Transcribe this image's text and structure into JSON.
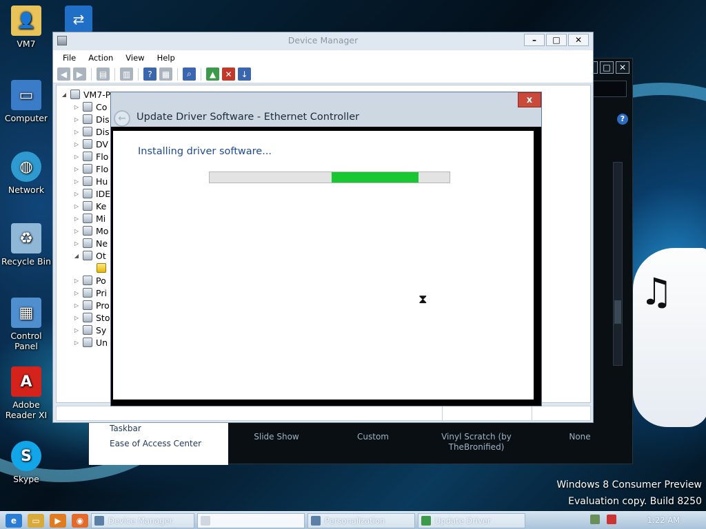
{
  "desktop": {
    "icons": [
      {
        "label": "VM7"
      },
      {
        "label": "Computer"
      },
      {
        "label": "Network"
      },
      {
        "label": "Recycle Bin"
      },
      {
        "label": "Control Panel"
      },
      {
        "label": "Adobe Reader XI"
      },
      {
        "label": "Skype"
      }
    ],
    "watermark": {
      "line1": "Windows 8 Consumer Preview",
      "line2": "Evaluation copy. Build 8250"
    }
  },
  "personalization_window": {
    "left_links": [
      "Taskbar",
      "Ease of Access Center"
    ],
    "themes": [
      "Slide Show",
      "Custom",
      "Vinyl Scratch (by TheBronified)",
      "None"
    ]
  },
  "device_manager": {
    "title": "Device Manager",
    "menu": [
      "File",
      "Action",
      "View",
      "Help"
    ],
    "tree": {
      "root": "VM7-PC",
      "items": [
        "Co",
        "Dis",
        "Dis",
        "DV",
        "Flo",
        "Flo",
        "Hu",
        "IDE",
        "Ke",
        "Mi",
        "Mo",
        "Ne",
        "Ot",
        "",
        "Po",
        "Pri",
        "Pro",
        "Sto",
        "Sy",
        "Un"
      ]
    }
  },
  "dialog": {
    "title": "Update Driver Software - Ethernet Controller",
    "close_label": "x",
    "heading": "Installing driver software...",
    "progress": {
      "segment_start": 0.51,
      "segment_end": 0.87
    },
    "colors": {
      "progress_fill": "#19c733",
      "heading": "#1f4b8f"
    }
  },
  "taskbar": {
    "tasks": [
      "Device Manager",
      "",
      "Personalization",
      "Update Driver"
    ],
    "clock": "1:22 AM"
  }
}
